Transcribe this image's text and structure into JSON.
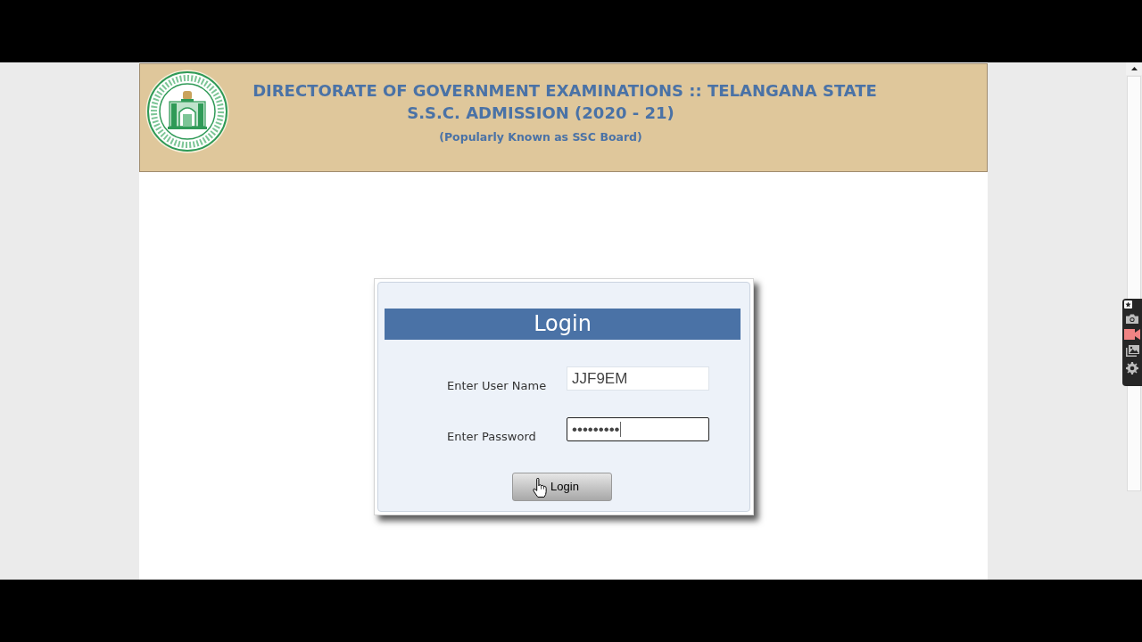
{
  "header": {
    "title_lines": [
      "DIRECTORATE OF GOVERNMENT EXAMINATIONS :: TELANGANA STATE",
      "S.S.C. ADMISSION (2020 - 21)"
    ],
    "subtitle": "(Popularly Known as SSC Board)"
  },
  "login": {
    "heading": "Login",
    "fields": [
      {
        "label": "Enter User Name",
        "value": "JJF9EM",
        "focused": false
      },
      {
        "label": "Enter Password",
        "value": "•••••••••",
        "focused": true
      }
    ],
    "button": "Login"
  }
}
